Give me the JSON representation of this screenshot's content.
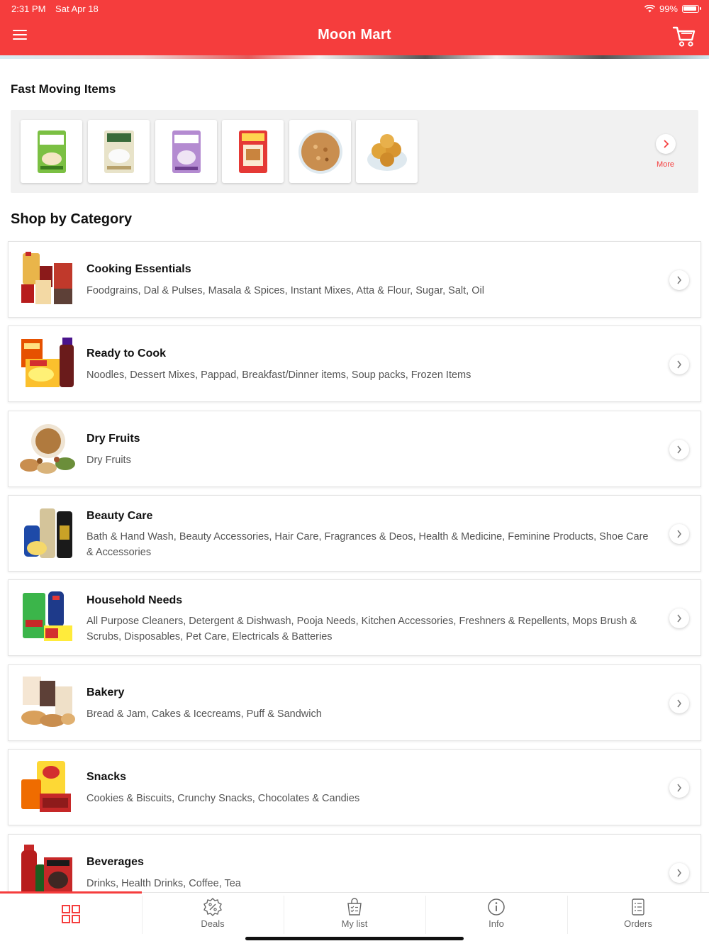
{
  "status": {
    "time": "2:31 PM",
    "date": "Sat Apr 18",
    "battery": "99%"
  },
  "header": {
    "title": "Moon Mart"
  },
  "fast_moving": {
    "title": "Fast Moving Items",
    "items": [
      {
        "icon": "dosa-mix-pack"
      },
      {
        "icon": "rice-pack"
      },
      {
        "icon": "snack-pack"
      },
      {
        "icon": "masala-pack"
      },
      {
        "icon": "mixture-bowl"
      },
      {
        "icon": "laddu-bowl"
      }
    ],
    "more_label": "More"
  },
  "categories_title": "Shop by Category",
  "categories": [
    {
      "name": "Cooking Essentials",
      "desc": "Foodgrains, Dal & Pulses, Masala & Spices, Instant Mixes, Atta & Flour, Sugar, Salt, Oil"
    },
    {
      "name": "Ready to Cook",
      "desc": "Noodles, Dessert Mixes, Pappad, Breakfast/Dinner items, Soup packs, Frozen Items"
    },
    {
      "name": "Dry Fruits",
      "desc": "Dry Fruits"
    },
    {
      "name": "Beauty Care",
      "desc": "Bath & Hand Wash, Beauty Accessories, Hair Care, Fragrances & Deos, Health & Medicine, Feminine Products, Shoe Care & Accessories"
    },
    {
      "name": "Household Needs",
      "desc": "All Purpose Cleaners, Detergent & Dishwash, Pooja Needs, Kitchen Accessories, Freshners & Repellents, Mops Brush & Scrubs, Disposables, Pet Care, Electricals & Batteries"
    },
    {
      "name": "Bakery",
      "desc": "Bread & Jam, Cakes & Icecreams, Puff & Sandwich"
    },
    {
      "name": "Snacks",
      "desc": "Cookies & Biscuits, Crunchy Snacks, Chocolates & Candies"
    },
    {
      "name": "Beverages",
      "desc": "Drinks, Health Drinks, Coffee, Tea"
    }
  ],
  "tabs": [
    {
      "label": "",
      "icon": "grid-icon",
      "active": true
    },
    {
      "label": "Deals",
      "icon": "percent-badge-icon"
    },
    {
      "label": "My list",
      "icon": "shopping-list-icon"
    },
    {
      "label": "Info",
      "icon": "info-icon"
    },
    {
      "label": "Orders",
      "icon": "orders-icon"
    }
  ],
  "colors": {
    "brand": "#f53d3d",
    "text": "#111111",
    "muted": "#555555"
  }
}
